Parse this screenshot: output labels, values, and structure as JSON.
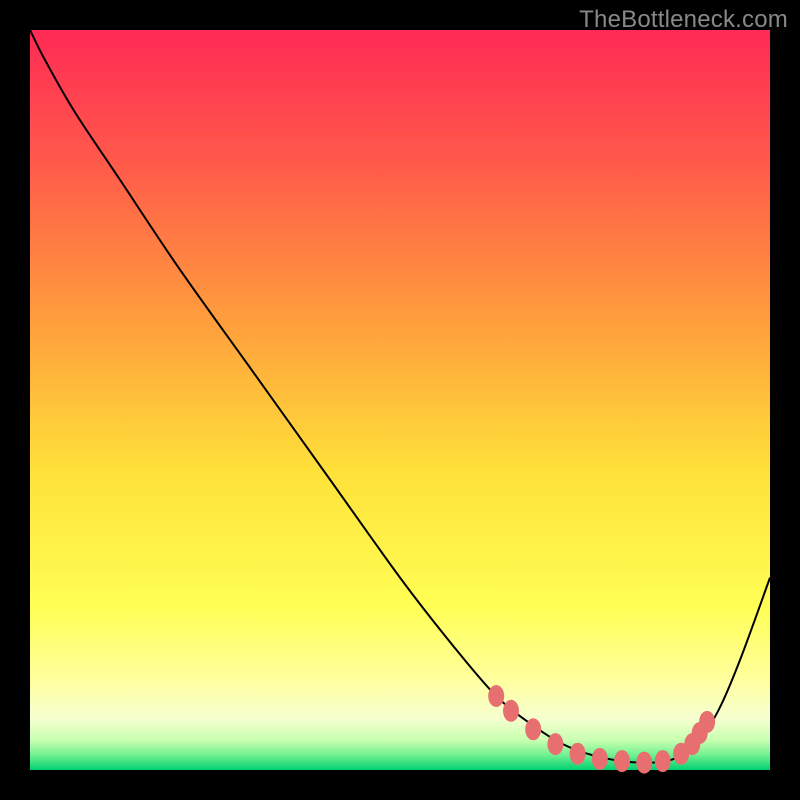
{
  "watermark": "TheBottleneck.com",
  "chart_data": {
    "type": "line",
    "title": "",
    "xlabel": "",
    "ylabel": "",
    "xlim": [
      0,
      1
    ],
    "ylim": [
      0,
      1
    ],
    "gradient_stops": [
      {
        "pct": 0,
        "color": "#ff2a55"
      },
      {
        "pct": 18,
        "color": "#ff5a4a"
      },
      {
        "pct": 40,
        "color": "#ffa03c"
      },
      {
        "pct": 60,
        "color": "#ffe23a"
      },
      {
        "pct": 78,
        "color": "#ffff55"
      },
      {
        "pct": 88,
        "color": "#ffffa0"
      },
      {
        "pct": 93,
        "color": "#f6ffd0"
      },
      {
        "pct": 96,
        "color": "#c8ffb0"
      },
      {
        "pct": 98,
        "color": "#70f090"
      },
      {
        "pct": 100,
        "color": "#00d070"
      }
    ],
    "series": [
      {
        "name": "bottleneck-curve",
        "x": [
          0.0,
          0.02,
          0.06,
          0.12,
          0.2,
          0.3,
          0.4,
          0.5,
          0.57,
          0.63,
          0.68,
          0.72,
          0.76,
          0.8,
          0.84,
          0.87,
          0.9,
          0.93,
          0.96,
          1.0
        ],
        "y": [
          1.0,
          0.96,
          0.89,
          0.8,
          0.68,
          0.54,
          0.4,
          0.26,
          0.17,
          0.1,
          0.06,
          0.035,
          0.02,
          0.012,
          0.01,
          0.015,
          0.035,
          0.08,
          0.15,
          0.26
        ]
      }
    ],
    "markers": {
      "name": "sweet-spot-markers",
      "color": "#e76f6f",
      "points": [
        {
          "x": 0.63,
          "y": 0.1
        },
        {
          "x": 0.65,
          "y": 0.08
        },
        {
          "x": 0.68,
          "y": 0.055
        },
        {
          "x": 0.71,
          "y": 0.035
        },
        {
          "x": 0.74,
          "y": 0.022
        },
        {
          "x": 0.77,
          "y": 0.015
        },
        {
          "x": 0.8,
          "y": 0.012
        },
        {
          "x": 0.83,
          "y": 0.01
        },
        {
          "x": 0.855,
          "y": 0.012
        },
        {
          "x": 0.88,
          "y": 0.022
        },
        {
          "x": 0.895,
          "y": 0.035
        },
        {
          "x": 0.905,
          "y": 0.05
        },
        {
          "x": 0.915,
          "y": 0.065
        }
      ]
    }
  }
}
